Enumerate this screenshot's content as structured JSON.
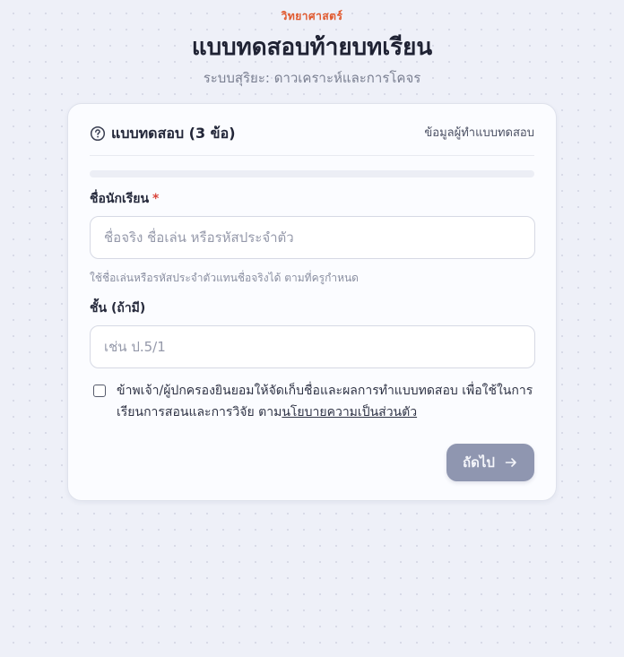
{
  "header": {
    "kicker": "วิทยาศาสตร์",
    "title": "แบบทดสอบท้ายบทเรียน",
    "subtitle": "ระบบสุริยะ: ดาวเคราะห์และการโคจร"
  },
  "card": {
    "title": "แบบทดสอบ (3 ข้อ)",
    "creator_link": "ข้อมูลผู้ทำแบบทดสอบ",
    "progress": 0
  },
  "form": {
    "name_label": "ชื่อนักเรียน",
    "required_mark": "*",
    "name_placeholder": "ชื่อจริง ชื่อเล่น หรือรหัสประจำตัว",
    "name_value": "",
    "name_hint": "ใช้ชื่อเล่นหรือรหัสประจำตัวแทนชื่อจริงได้ ตามที่ครูกำหนด",
    "class_label": "ชั้น (ถ้ามี)",
    "class_placeholder": "เช่น ป.5/1",
    "class_value": "",
    "consent_text": "ข้าพเจ้า/ผู้ปกครองยินยอมให้จัดเก็บชื่อและผลการทำแบบทดสอบ เพื่อใช้ในการเรียนการสอนและการวิจัย ตาม",
    "consent_link": "นโยบายความเป็นส่วนตัว",
    "consent_checked": false
  },
  "actions": {
    "next_label": "ถัดไป"
  },
  "icons": {
    "quiz": "question-circle-icon",
    "next": "arrow-right-icon"
  },
  "colors": {
    "accent": "#e0582d",
    "button": "#8f96b0",
    "required": "#d9453b"
  }
}
